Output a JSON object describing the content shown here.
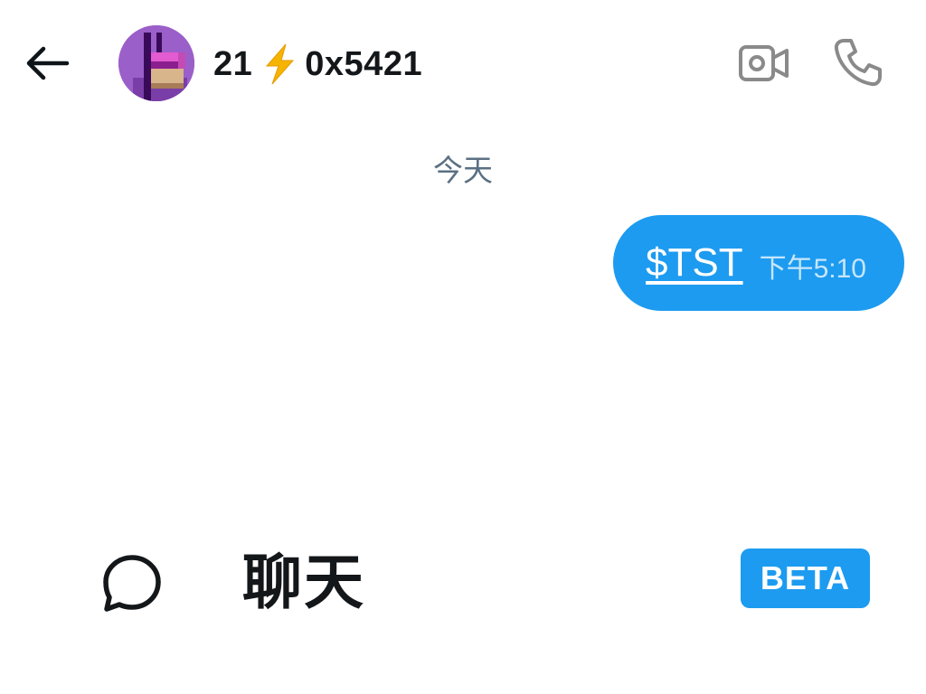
{
  "header": {
    "back_icon": "arrow-left-icon",
    "avatar_icon": "pixel-art-avatar",
    "title_prefix": "21",
    "title_bolt": "lightning-bolt-emoji",
    "title_suffix": "0x5421",
    "video_icon": "video-camera-icon",
    "call_icon": "phone-icon"
  },
  "conversation": {
    "date_separator": "今天",
    "messages": [
      {
        "text": "$TST",
        "time": "下午5:10",
        "outgoing": true
      }
    ]
  },
  "bottom_bar": {
    "chat_icon": "chat-bubble-icon",
    "label": "聊天",
    "badge": "BETA"
  },
  "colors": {
    "accent": "#1d9bf0",
    "secondary_text": "#5b7083",
    "icon_gray": "#8a8a8a",
    "bolt": "#f5b400"
  }
}
